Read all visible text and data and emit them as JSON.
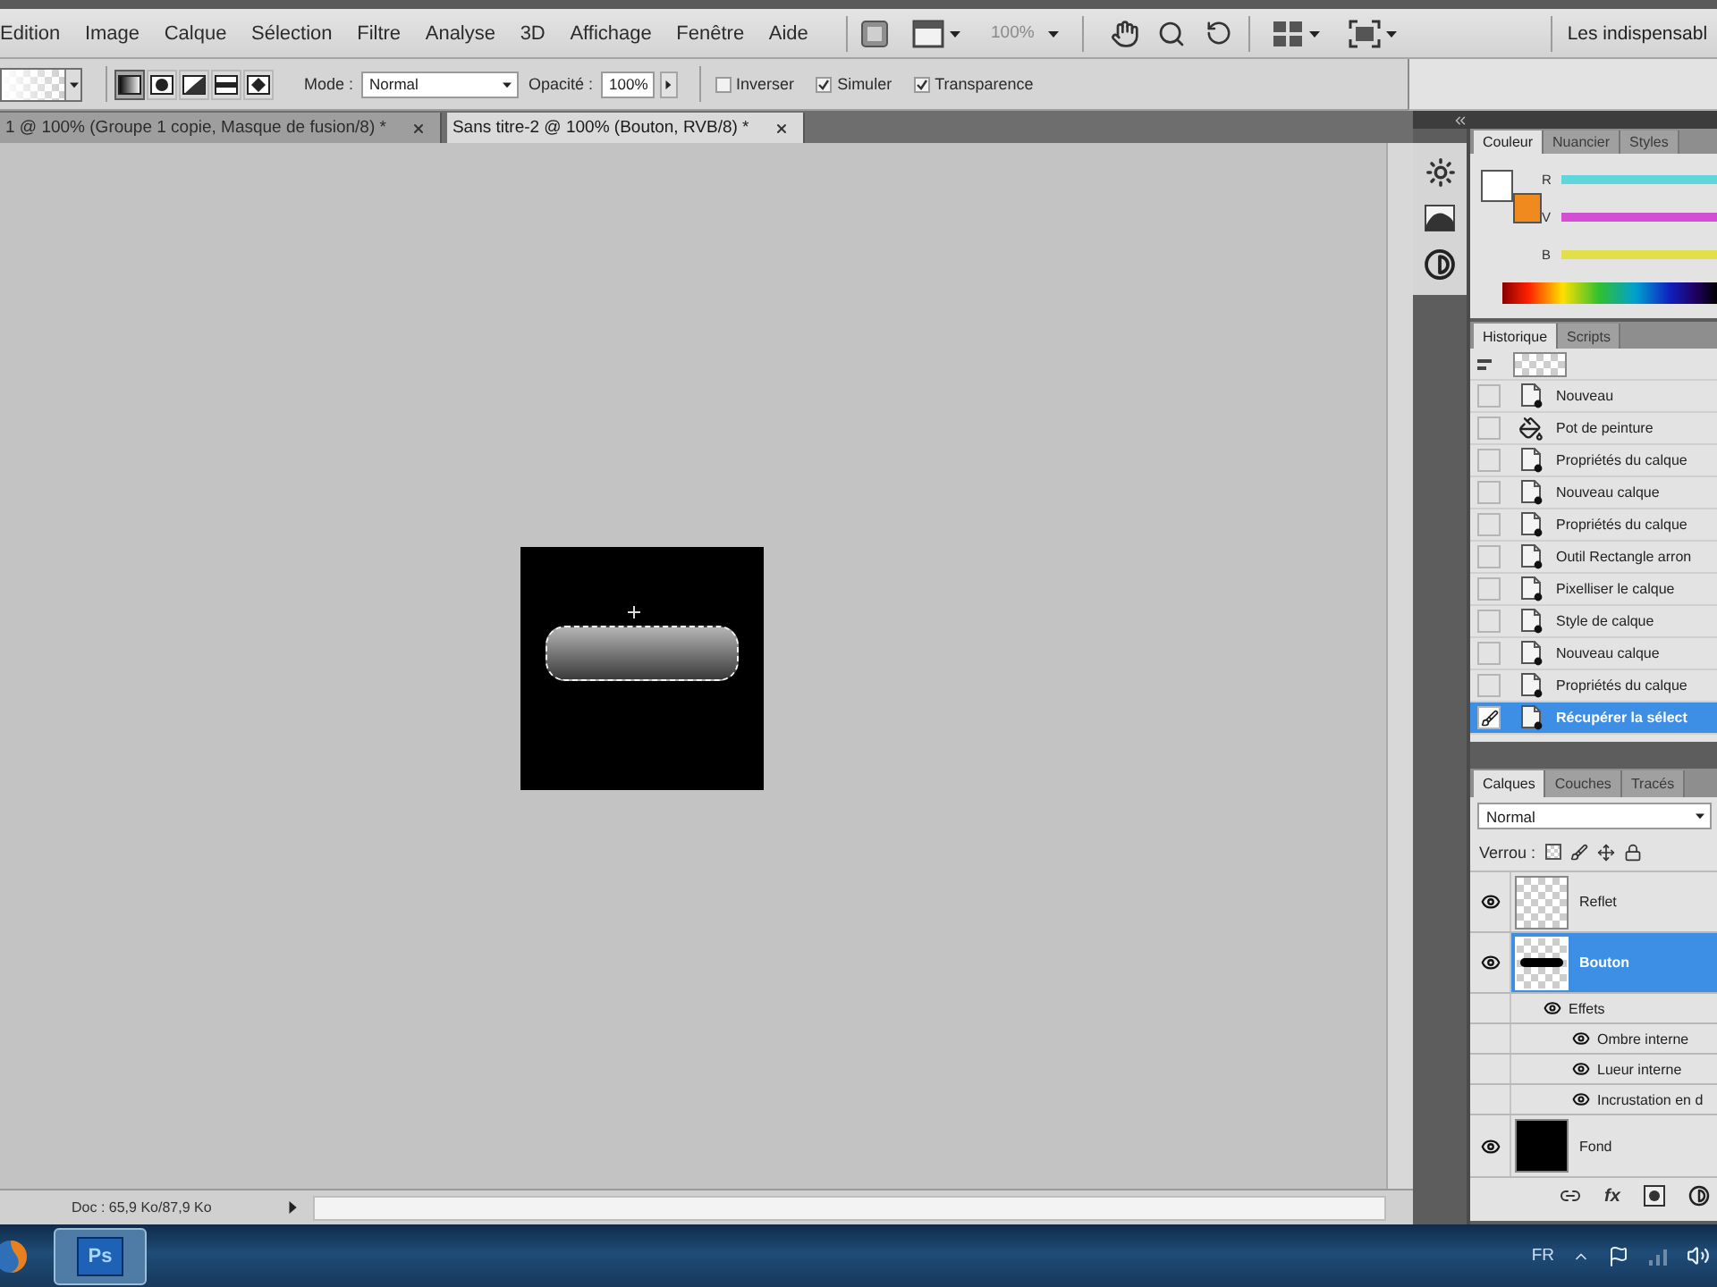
{
  "menu_bar": {
    "items": [
      "Edition",
      "Image",
      "Calque",
      "Sélection",
      "Filtre",
      "Analyse",
      "3D",
      "Affichage",
      "Fenêtre",
      "Aide"
    ],
    "zoom": "100%",
    "workspace": "Les indispensabl"
  },
  "options_bar": {
    "gradient_types": [
      {
        "kind": "linear",
        "selected": true
      },
      {
        "kind": "radial",
        "selected": false
      },
      {
        "kind": "angle",
        "selected": false
      },
      {
        "kind": "reflected",
        "selected": false
      },
      {
        "kind": "diamond",
        "selected": false
      }
    ],
    "mode_label": "Mode :",
    "mode": "Normal",
    "opacity_label": "Opacité :",
    "opacity": "100%",
    "options": [
      {
        "label": "Inverser",
        "checked": false
      },
      {
        "label": "Simuler",
        "checked": true
      },
      {
        "label": "Transparence",
        "checked": true
      }
    ]
  },
  "document_tabs": [
    {
      "label": "1 @ 100% (Groupe 1 copie, Masque de fusion/8) *",
      "selected": false
    },
    {
      "label": "Sans titre-2 @ 100% (Bouton, RVB/8) *",
      "selected": true
    }
  ],
  "status_bar": {
    "doc_info": "Doc : 65,9 Ko/87,9 Ko"
  },
  "color_panel": {
    "tabs": [
      {
        "label": "Couleur",
        "selected": true
      },
      {
        "label": "Nuancier",
        "selected": false
      },
      {
        "label": "Styles",
        "selected": false
      }
    ],
    "swatches": [
      {
        "kind": "foreground",
        "color": "#ffffff"
      },
      {
        "kind": "background",
        "color": "#f0891e"
      }
    ],
    "channels": [
      {
        "label": "R",
        "color": "#5ed6dc"
      },
      {
        "label": "V",
        "color": "#d24fd4"
      },
      {
        "label": "B",
        "color": "#e2e04a"
      }
    ]
  },
  "history_panel": {
    "tabs": [
      {
        "label": "Historique",
        "selected": true
      },
      {
        "label": "Scripts",
        "selected": false
      }
    ],
    "steps": [
      {
        "label": "Nouveau",
        "kind": "document",
        "selected": false
      },
      {
        "label": "Pot de peinture",
        "kind": "paint-bucket",
        "selected": false
      },
      {
        "label": "Propriétés du calque",
        "kind": "document",
        "selected": false
      },
      {
        "label": "Nouveau calque",
        "kind": "document",
        "selected": false
      },
      {
        "label": "Propriétés du calque",
        "kind": "document",
        "selected": false
      },
      {
        "label": "Outil Rectangle arron",
        "kind": "document",
        "selected": false
      },
      {
        "label": "Pixelliser le calque",
        "kind": "document",
        "selected": false
      },
      {
        "label": "Style de calque",
        "kind": "document",
        "selected": false
      },
      {
        "label": "Nouveau calque",
        "kind": "document",
        "selected": false
      },
      {
        "label": "Propriétés du calque",
        "kind": "document",
        "selected": false
      },
      {
        "label": "Récupérer la sélect",
        "kind": "document",
        "selected": true
      }
    ]
  },
  "layers_panel": {
    "tabs": [
      {
        "label": "Calques",
        "selected": true
      },
      {
        "label": "Couches",
        "selected": false
      },
      {
        "label": "Tracés",
        "selected": false
      }
    ],
    "blend_mode": "Normal",
    "lock_label": "Verrou :",
    "layers": [
      {
        "name": "Reflet",
        "kind": "transparent",
        "visible": true,
        "selected": false
      },
      {
        "name": "Bouton",
        "kind": "bar",
        "visible": true,
        "selected": true,
        "effects_label": "Effets",
        "effects": [
          {
            "name": "Ombre interne",
            "visible": true
          },
          {
            "name": "Lueur interne",
            "visible": true
          },
          {
            "name": "Incrustation en d",
            "visible": true
          }
        ]
      },
      {
        "name": "Fond",
        "kind": "black",
        "visible": true,
        "selected": false
      }
    ],
    "fx_label": "fx"
  },
  "taskbar": {
    "app_label": "Ps",
    "language": "FR"
  }
}
